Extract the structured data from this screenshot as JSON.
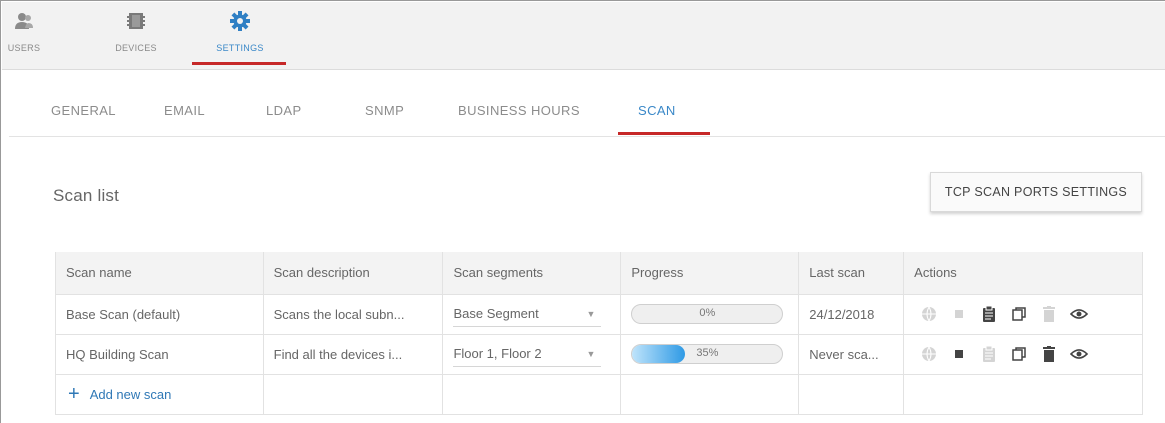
{
  "nav": {
    "items": [
      {
        "label": "USERS",
        "icon": "users-icon"
      },
      {
        "label": "DEVICES",
        "icon": "devices-icon"
      },
      {
        "label": "SETTINGS",
        "icon": "gear-icon"
      }
    ],
    "active": "SETTINGS"
  },
  "tabs": {
    "items": [
      "GENERAL",
      "EMAIL",
      "LDAP",
      "SNMP",
      "BUSINESS HOURS",
      "SCAN"
    ],
    "active": "SCAN"
  },
  "scan_list": {
    "title": "Scan list",
    "tcp_button": "TCP SCAN PORTS SETTINGS",
    "columns": [
      "Scan name",
      "Scan description",
      "Scan segments",
      "Progress",
      "Last scan",
      "Actions"
    ],
    "rows": [
      {
        "name": "Base Scan (default)",
        "description": "Scans the local subn...",
        "segments": "Base Segment",
        "progress": 0,
        "progress_label": "0%",
        "last_scan": "24/12/2018",
        "actions_enabled": {
          "globe": false,
          "stop": false,
          "clipboard": true,
          "copy": true,
          "delete": false,
          "view": true
        }
      },
      {
        "name": "HQ Building Scan",
        "description": "Find all the devices i...",
        "segments": "Floor 1, Floor 2",
        "progress": 35,
        "progress_label": "35%",
        "last_scan": "Never sca...",
        "actions_enabled": {
          "globe": false,
          "stop": true,
          "clipboard": false,
          "copy": true,
          "delete": true,
          "view": true
        }
      }
    ],
    "add_label": "Add new scan"
  },
  "colors": {
    "accent_blue": "#3a88c8",
    "active_underline": "#c62828",
    "progress_fill": "#2f9ae5"
  }
}
